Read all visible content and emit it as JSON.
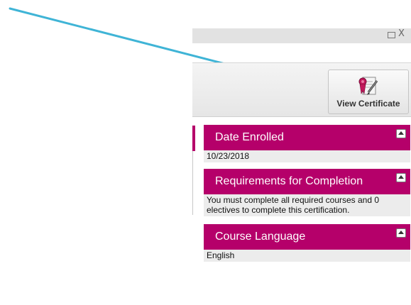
{
  "window": {
    "maximize_icon": "maximize-icon",
    "close_glyph": "X"
  },
  "toolbar": {
    "view_certificate_label": "View Certificate",
    "certificate_icon": "certificate-ribbon-icon"
  },
  "panels": [
    {
      "title": "Date Enrolled",
      "body": "10/23/2018"
    },
    {
      "title": "Requirements for Completion",
      "body": "You must complete all required courses and 0 electives to complete this certification."
    },
    {
      "title": "Course Language",
      "body": "English"
    }
  ],
  "colors": {
    "accent": "#b5006a",
    "arrow": "#3fb4d6",
    "panel_body_bg": "#ececec"
  }
}
